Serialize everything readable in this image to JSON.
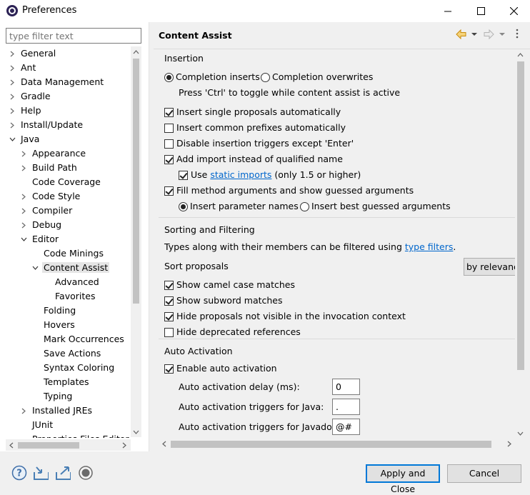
{
  "window": {
    "title": "Preferences",
    "icon": "eclipse-icon"
  },
  "filter": {
    "placeholder": "type filter text"
  },
  "tree": {
    "items": [
      {
        "label": "General",
        "level": 0,
        "twisty": "collapsed"
      },
      {
        "label": "Ant",
        "level": 0,
        "twisty": "collapsed"
      },
      {
        "label": "Data Management",
        "level": 0,
        "twisty": "collapsed"
      },
      {
        "label": "Gradle",
        "level": 0,
        "twisty": "collapsed"
      },
      {
        "label": "Help",
        "level": 0,
        "twisty": "collapsed"
      },
      {
        "label": "Install/Update",
        "level": 0,
        "twisty": "collapsed"
      },
      {
        "label": "Java",
        "level": 0,
        "twisty": "expanded"
      },
      {
        "label": "Appearance",
        "level": 1,
        "twisty": "collapsed"
      },
      {
        "label": "Build Path",
        "level": 1,
        "twisty": "collapsed"
      },
      {
        "label": "Code Coverage",
        "level": 1,
        "twisty": "none"
      },
      {
        "label": "Code Style",
        "level": 1,
        "twisty": "collapsed"
      },
      {
        "label": "Compiler",
        "level": 1,
        "twisty": "collapsed"
      },
      {
        "label": "Debug",
        "level": 1,
        "twisty": "collapsed"
      },
      {
        "label": "Editor",
        "level": 1,
        "twisty": "expanded"
      },
      {
        "label": "Code Minings",
        "level": 2,
        "twisty": "none"
      },
      {
        "label": "Content Assist",
        "level": 2,
        "twisty": "expanded",
        "selected": true
      },
      {
        "label": "Advanced",
        "level": 3,
        "twisty": "none"
      },
      {
        "label": "Favorites",
        "level": 3,
        "twisty": "none"
      },
      {
        "label": "Folding",
        "level": 2,
        "twisty": "none"
      },
      {
        "label": "Hovers",
        "level": 2,
        "twisty": "none"
      },
      {
        "label": "Mark Occurrences",
        "level": 2,
        "twisty": "none"
      },
      {
        "label": "Save Actions",
        "level": 2,
        "twisty": "none"
      },
      {
        "label": "Syntax Coloring",
        "level": 2,
        "twisty": "none"
      },
      {
        "label": "Templates",
        "level": 2,
        "twisty": "none"
      },
      {
        "label": "Typing",
        "level": 2,
        "twisty": "none"
      },
      {
        "label": "Installed JREs",
        "level": 1,
        "twisty": "collapsed"
      },
      {
        "label": "JUnit",
        "level": 1,
        "twisty": "none"
      },
      {
        "label": "Properties Files Editor",
        "level": 1,
        "twisty": "none"
      }
    ]
  },
  "page": {
    "title": "Content Assist",
    "insertion": {
      "title": "Insertion",
      "radio_inserts": "Completion inserts",
      "radio_overwrites": "Completion overwrites",
      "toggle_hint": "Press 'Ctrl' to toggle while content assist is active",
      "single_proposals": "Insert single proposals automatically",
      "common_prefixes": "Insert common prefixes automatically",
      "disable_triggers": "Disable insertion triggers except 'Enter'",
      "add_import": "Add import instead of qualified name",
      "use_prefix": "Use",
      "static_imports_link": "static imports",
      "use_suffix": "(only 1.5 or higher)",
      "fill_args": "Fill method arguments and show guessed arguments",
      "param_names": "Insert parameter names",
      "best_guessed": "Insert best guessed arguments"
    },
    "sorting": {
      "title": "Sorting and Filtering",
      "types_text_prefix": "Types along with their members can be filtered using",
      "type_filters_link": "type filters",
      "types_text_suffix": ".",
      "sort_label": "Sort proposals",
      "sort_value": "by relevance",
      "camel_case": "Show camel case matches",
      "subword": "Show subword matches",
      "hide_not_visible": "Hide proposals not visible in the invocation context",
      "hide_deprecated": "Hide deprecated references"
    },
    "auto_activation": {
      "title": "Auto Activation",
      "enable": "Enable auto activation",
      "delay_label": "Auto activation delay (ms):",
      "delay_value": "0",
      "java_triggers_label": "Auto activation triggers for Java:",
      "java_triggers_value": ".",
      "javadoc_triggers_label": "Auto activation triggers for Javadoc:",
      "javadoc_triggers_value": "@#"
    }
  },
  "buttons": {
    "apply_close": "Apply and Close",
    "cancel": "Cancel"
  },
  "bottom_icons": [
    "help-icon",
    "import-icon",
    "export-icon",
    "record-icon"
  ],
  "colors": {
    "accent": "#0078d7",
    "link": "#0066cc",
    "nav_arrow": "#e8a317"
  }
}
